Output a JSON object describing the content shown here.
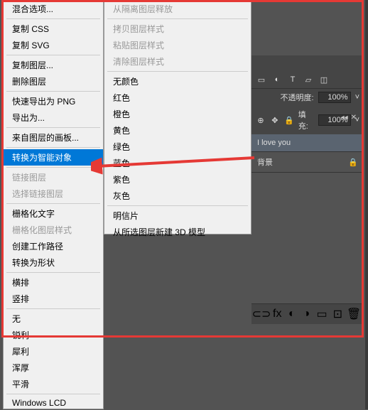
{
  "menu_left": {
    "items": [
      {
        "label": "混合选项...",
        "sub": false
      },
      {
        "sep": true
      },
      {
        "label": "复制 CSS",
        "sub": false
      },
      {
        "label": "复制 SVG",
        "sub": false
      },
      {
        "sep": true
      },
      {
        "label": "复制图层...",
        "sub": false
      },
      {
        "label": "删除图层",
        "sub": false
      },
      {
        "sep": true
      },
      {
        "label": "快速导出为 PNG",
        "sub": false
      },
      {
        "label": "导出为...",
        "sub": false
      },
      {
        "sep": true
      },
      {
        "label": "来自图层的画板...",
        "sub": false
      },
      {
        "sep": true
      },
      {
        "label": "转换为智能对象",
        "highlighted": true,
        "sub": false
      },
      {
        "sep": true
      },
      {
        "label": "链接图层",
        "disabled": true,
        "sub": false
      },
      {
        "label": "选择链接图层",
        "disabled": true,
        "sub": false
      },
      {
        "sep": true
      },
      {
        "label": "栅格化文字",
        "sub": false
      },
      {
        "label": "栅格化图层样式",
        "disabled": true,
        "sub": false
      },
      {
        "label": "创建工作路径",
        "sub": false
      },
      {
        "label": "转换为形状",
        "sub": false
      },
      {
        "sep": true
      },
      {
        "label": "横排",
        "sub": false
      },
      {
        "label": "竖排",
        "sub": false
      },
      {
        "sep": true
      },
      {
        "label": "无",
        "sub": false
      },
      {
        "label": "锐利",
        "sub": false
      },
      {
        "label": "犀利",
        "sub": false
      },
      {
        "label": "浑厚",
        "sub": false
      },
      {
        "label": "平滑",
        "sub": false
      },
      {
        "sep": true
      },
      {
        "label": "Windows LCD",
        "sub": false
      }
    ]
  },
  "menu_right": {
    "items": [
      {
        "label": "从隔离图层释放",
        "disabled": true
      },
      {
        "sep": true
      },
      {
        "label": "拷贝图层样式",
        "disabled": true
      },
      {
        "label": "粘贴图层样式",
        "disabled": true
      },
      {
        "label": "清除图层样式",
        "disabled": true
      },
      {
        "sep": true
      },
      {
        "label": "无颜色"
      },
      {
        "label": "红色"
      },
      {
        "label": "橙色"
      },
      {
        "label": "黄色"
      },
      {
        "label": "绿色"
      },
      {
        "label": "蓝色"
      },
      {
        "label": "紫色"
      },
      {
        "label": "灰色"
      },
      {
        "sep": true
      },
      {
        "label": "明信片"
      },
      {
        "label": "从所选图层新建 3D 模型"
      }
    ]
  },
  "panel": {
    "opacity_label": "不透明度:",
    "opacity_value": "100%",
    "fill_label": "填充:",
    "fill_value": "100%",
    "layers": [
      {
        "name": "I love you"
      },
      {
        "name": "背景",
        "locked": true
      }
    ]
  }
}
